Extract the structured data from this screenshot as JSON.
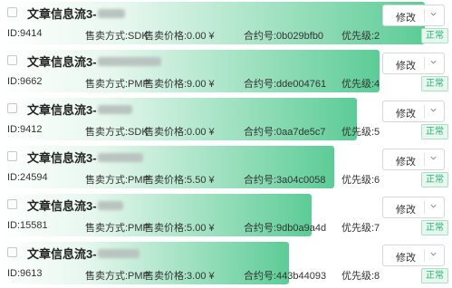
{
  "colors": {
    "bar_start": "#ffffff",
    "bar_end": "#5ccc96",
    "status_text": "#27b373",
    "status_bg": "#e7f7ef"
  },
  "labels": {
    "sale_mode_prefix": "售卖方式:",
    "sale_price_prefix": "售卖价格:",
    "contract_prefix": "合约号:",
    "priority_prefix": "优先级:",
    "edit_button": "修改",
    "status": "正常"
  },
  "rows": [
    {
      "title": "文章信息流3-",
      "id": "ID:9414",
      "sale_mode": "售卖方式:SDK",
      "sale_price": "售卖价格:0.00 ¥",
      "contract": "合约号:0b029bfb0",
      "priority": "优先级:2",
      "edit_label": "修改",
      "status": "正常",
      "progress": 0.94
    },
    {
      "title": "文章信息流3-",
      "id": "ID:9662",
      "sale_mode": "售卖方式:PMP",
      "sale_price": "售卖价格:9.00 ¥",
      "contract": "合约号:dde004761",
      "priority": "优先级:4",
      "edit_label": "修改",
      "status": "正常",
      "progress": 0.84
    },
    {
      "title": "文章信息流3-",
      "id": "ID:9412",
      "sale_mode": "售卖方式:SDK",
      "sale_price": "售卖价格:0.00 ¥",
      "contract": "合约号:0aa7de5c7",
      "priority": "优先级:5",
      "edit_label": "修改",
      "status": "正常",
      "progress": 0.79
    },
    {
      "title": "文章信息流3-",
      "id": "ID:24594",
      "sale_mode": "售卖方式:PMP",
      "sale_price": "售卖价格:5.50 ¥",
      "contract": "合约号:3a04c0058",
      "priority": "优先级:6",
      "edit_label": "修改",
      "status": "正常",
      "progress": 0.74
    },
    {
      "title": "文章信息流3-",
      "id": "ID:15581",
      "sale_mode": "售卖方式:PMP",
      "sale_price": "售卖价格:5.00 ¥",
      "contract": "合约号:9db0a9a4d",
      "priority": "优先级:7",
      "edit_label": "修改",
      "status": "正常",
      "progress": 0.69
    },
    {
      "title": "文章信息流3-",
      "id": "ID:9613",
      "sale_mode": "售卖方式:PMP",
      "sale_price": "售卖价格:3.00 ¥",
      "contract": "合约号:443b44093",
      "priority": "优先级:8",
      "edit_label": "修改",
      "status": "正常",
      "progress": 0.64
    }
  ]
}
